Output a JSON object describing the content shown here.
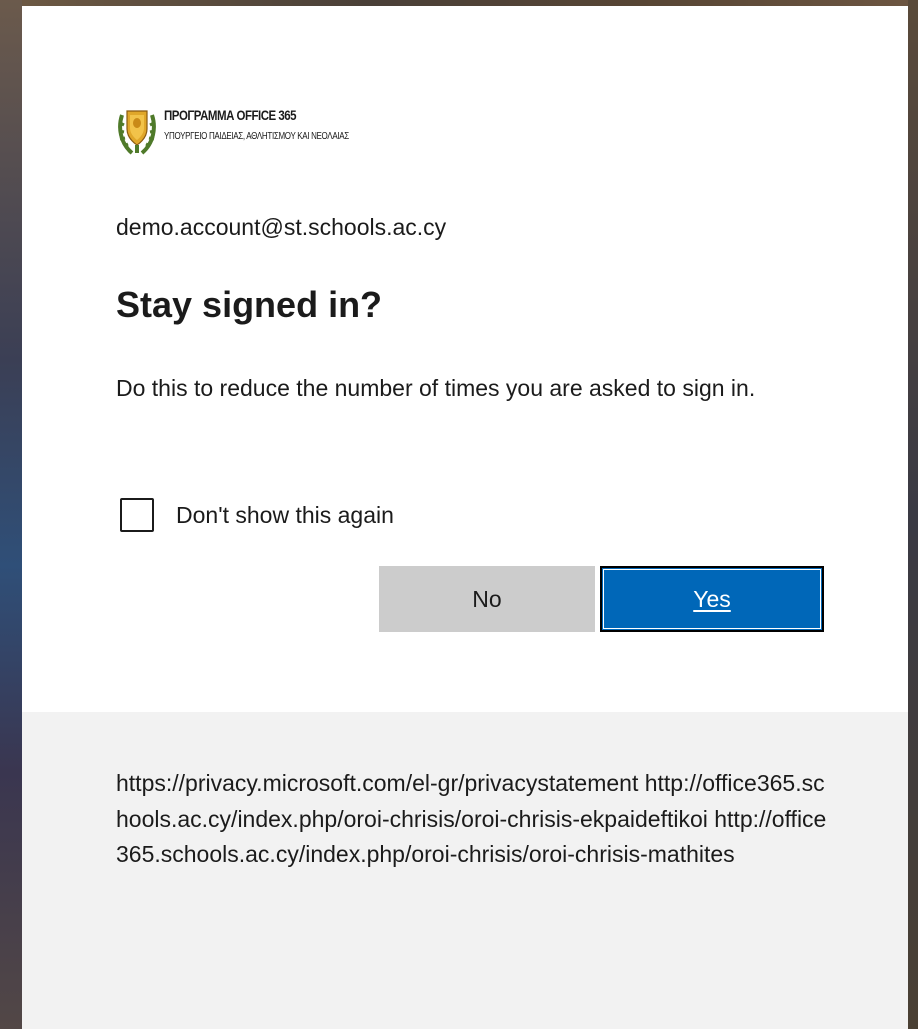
{
  "logo": {
    "title": "ΠΡΟΓΡΑΜΜΑ OFFICE 365",
    "subtitle": "ΥΠΟΥΡΓΕΙΟ ΠΑΙΔΕΙΑΣ, ΑΘΛΗΤΙΣΜΟΥ ΚΑΙ ΝΕΟΛΑΙΑΣ"
  },
  "account": {
    "email": "demo.account@st.schools.ac.cy"
  },
  "dialog": {
    "title": "Stay signed in?",
    "description": "Do this to reduce the number of times you are asked to sign in.",
    "checkbox_label": "Don't show this again",
    "checkbox_checked": false,
    "no_label": "No",
    "yes_label": "Yes"
  },
  "footer": {
    "links": [
      "https://privacy.microsoft.com/el-gr/privacystatement",
      "http://office365.schools.ac.cy/index.php/oroi-chrisis/oroi-chrisis-ekpaideftikoi",
      "http://office365.schools.ac.cy/index.php/oroi-chrisis/oroi-chrisis-mathites"
    ]
  },
  "colors": {
    "primary_button": "#0067b8",
    "secondary_button": "#cccccc",
    "footer_bg": "#f2f2f2"
  }
}
